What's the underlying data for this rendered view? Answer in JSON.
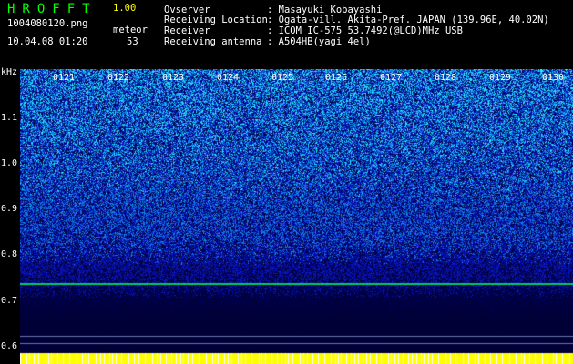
{
  "app": {
    "name": "HROFFT",
    "version": "1.00"
  },
  "file": {
    "name": "1004080120.png",
    "datetime": "10.04.08 01:20"
  },
  "event": {
    "label": "meteor",
    "count": "53"
  },
  "info": [
    {
      "label": "Ovserver",
      "value": ": Masayuki Kobayashi"
    },
    {
      "label": "Receiving Location",
      "value": ": Ogata-vill. Akita-Pref. JAPAN (139.96E, 40.02N)"
    },
    {
      "label": "Receiver",
      "value": ": ICOM IC-575 53.7492(@LCD)MHz USB"
    },
    {
      "label": "Receiving antenna",
      "value": ": A504HB(yagi 4el)"
    }
  ],
  "axis": {
    "unit": "kHz",
    "ticks": [
      "1.1",
      "1.0",
      "0.9",
      "0.8",
      "0.7",
      "0.6"
    ]
  },
  "time_marks": [
    "0121",
    "0122",
    "0123",
    "0124",
    "0125",
    "0126",
    "0127",
    "0128",
    "0129",
    "0130"
  ],
  "colors": {
    "title": "#00ff00",
    "version": "#ffff00",
    "signal_line": "#00cc66",
    "bottom_bar": "#ffff00"
  }
}
